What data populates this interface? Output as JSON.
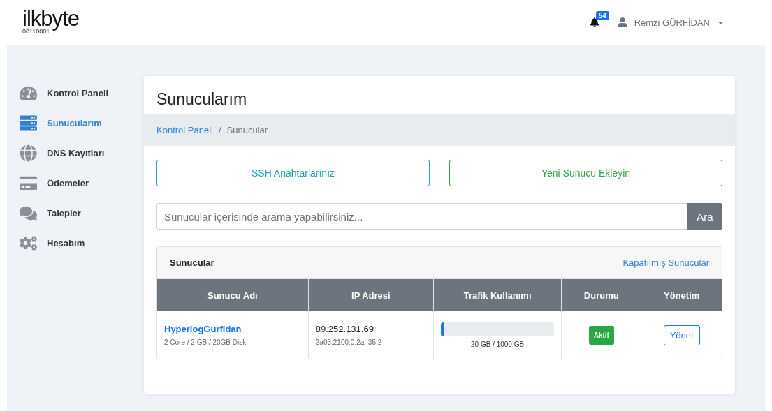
{
  "header": {
    "logo": "ilkbyte",
    "logo_sub": "00110001",
    "notifications": "54",
    "user": "Remzi GÜRFİDAN"
  },
  "sidebar": {
    "items": [
      {
        "label": "Kontrol Paneli",
        "kind": "dashboard",
        "selected": false
      },
      {
        "label": "Sunucularım",
        "kind": "servers",
        "selected": true
      },
      {
        "label": "DNS Kayıtları",
        "kind": "dns",
        "selected": false
      },
      {
        "label": "Ödemeler",
        "kind": "payments",
        "selected": false
      },
      {
        "label": "Talepler",
        "kind": "tickets",
        "selected": false
      },
      {
        "label": "Hesabım",
        "kind": "account",
        "selected": false
      }
    ]
  },
  "page": {
    "title": "Sunucularım",
    "breadcrumb_separator": "/",
    "breadcrumb": [
      {
        "label": "Kontrol Paneli",
        "link": true
      },
      {
        "label": "Sunucular",
        "link": false
      }
    ],
    "actions": [
      {
        "label": "SSH Anahtarlarınız",
        "kind": "info"
      },
      {
        "label": "Yeni Sunucu Ekleyin",
        "kind": "success"
      }
    ],
    "search": {
      "placeholder": "Sunucular içerisinde arama yapabilirsiniz...",
      "button": "Ara"
    },
    "panel": {
      "title": "Sunucular",
      "link": "Kapatılmış Sunucular",
      "table": {
        "columns": [
          "Sunucu Adı",
          "IP Adresi",
          "Trafik Kullanımı",
          "Durumu",
          "Yönetim"
        ],
        "rows": [
          {
            "name": "HyperlogGurfidan",
            "specs": "2 Core / 2 GB / 20GB Disk",
            "ip": "89.252.131.69",
            "ipv6": "2a03:2100:0:2a::35:2",
            "traffic": {
              "level": 0.02,
              "reading": "20 GB / 1000 GB"
            },
            "status": "Aktif",
            "action": "Yönet"
          }
        ]
      }
    }
  }
}
